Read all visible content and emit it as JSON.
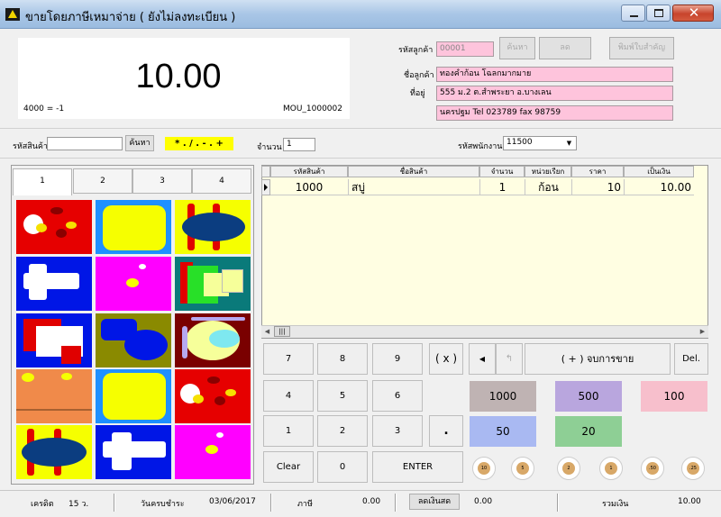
{
  "window": {
    "title": "ขายโดยภาษีเหมาจ่าย ( ยังไม่ลงทะเบียน )"
  },
  "display": {
    "value": "10.00",
    "left_note": "4000 = -1",
    "right_note": "MOU_1000002"
  },
  "customer": {
    "code_label": "รหัสลูกค้า",
    "code": "00001",
    "find_label": "ค้นหา",
    "add_label": "ลด",
    "print_label": "พิมพ์ใบสำคัญ",
    "name_label": "ชื่อลูกค้า",
    "name": "ทองคำก้อน โฉลกมากมาย",
    "addr_label": "ที่อยู่",
    "addr1": "555 ม.2 ต.สำพระยา  อ.บางเลน",
    "addr2": "นครปฐม Tel 023789 fax 98759"
  },
  "entry": {
    "product_label": "รหัสสินค้า",
    "product_value": "",
    "find_label": "ค้นหา",
    "hint": "* . / . - . +",
    "qty_label": "จำนวน",
    "qty_value": "1",
    "staff_label": "รหัสพนักงาน",
    "staff_value": "11500"
  },
  "tabs": [
    "1",
    "2",
    "3",
    "4"
  ],
  "grid": {
    "headers": [
      "รหัสสินค้า",
      "ชื่อสินค้า",
      "จำนวน",
      "หน่วยเรียก",
      "ราคา",
      "เป็นเงิน"
    ],
    "rows": [
      [
        "1000",
        "สบู่",
        "1",
        "ก้อน",
        "10",
        "10.00"
      ]
    ]
  },
  "keypad": {
    "k7": "7",
    "k8": "8",
    "k9": "9",
    "k4": "4",
    "k5": "5",
    "k6": "6",
    "k1": "1",
    "k2": "2",
    "k3": "3",
    "k0": "0",
    "mult": "( x )",
    "dot": ".",
    "clear": "Clear",
    "enter": "ENTER",
    "finish": "( + ) จบการขาย",
    "del": "Del."
  },
  "money": {
    "b1000": "1000",
    "b500": "500",
    "b100": "100",
    "b50": "50",
    "b20": "20",
    "colors": {
      "b1000": "#bfb3b3",
      "b500": "#b9a6de",
      "b100": "#f7bfcc",
      "b50": "#a9b9f2",
      "b20": "#8ecf95"
    }
  },
  "coins": [
    "10",
    "5",
    "2",
    "1",
    ".50",
    ".25"
  ],
  "status": {
    "credit_label": "เครดิต",
    "credit_value": "15 ว.",
    "due_label": "วันครบชำระ",
    "due_value": "03/06/2017",
    "tax_label": "ภาษี",
    "tax_value": "0.00",
    "change_label": "ลดเงินสด",
    "change_value": "0.00",
    "total_label": "รวมเงิน",
    "total_value": "10.00"
  }
}
